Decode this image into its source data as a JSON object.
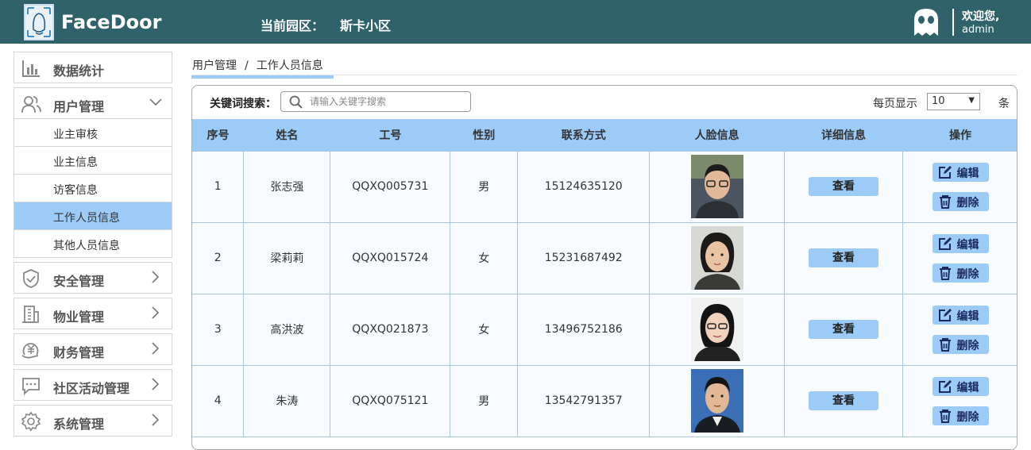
{
  "header": {
    "brand": "FaceDoor",
    "park_label": "当前园区：",
    "park_name": "斯卡小区",
    "welcome": "欢迎您,",
    "username": "admin"
  },
  "sidebar": {
    "items": [
      {
        "label": "数据统计",
        "icon": "bar-chart-icon"
      },
      {
        "label": "用户管理",
        "icon": "users-icon",
        "expanded": true
      },
      {
        "label": "安全管理",
        "icon": "shield-icon"
      },
      {
        "label": "物业管理",
        "icon": "building-icon"
      },
      {
        "label": "财务管理",
        "icon": "money-icon"
      },
      {
        "label": "社区活动管理",
        "icon": "chat-icon"
      },
      {
        "label": "系统管理",
        "icon": "gear-icon"
      }
    ],
    "sub_items": [
      {
        "label": "业主审核"
      },
      {
        "label": "业主信息"
      },
      {
        "label": "访客信息"
      },
      {
        "label": "工作人员信息",
        "active": true
      },
      {
        "label": "其他人员信息"
      }
    ]
  },
  "breadcrumb": {
    "parent": "用户管理",
    "separator": "/",
    "current": "工作人员信息"
  },
  "search": {
    "label": "关键词搜索：",
    "placeholder": "请输入关键字搜索",
    "value": ""
  },
  "pagination": {
    "label": "每页显示",
    "selected": "10",
    "unit": "条"
  },
  "table": {
    "columns": [
      "序号",
      "姓名",
      "工号",
      "性别",
      "联系方式",
      "人脸信息",
      "详细信息",
      "操作"
    ],
    "view_label": "查看",
    "edit_label": "编辑",
    "delete_label": "删除",
    "rows": [
      {
        "no": "1",
        "name": "张志强",
        "id": "QQXQ005731",
        "gender": "男",
        "phone": "15124635120"
      },
      {
        "no": "2",
        "name": "梁莉莉",
        "id": "QQXQ015724",
        "gender": "女",
        "phone": "15231687492"
      },
      {
        "no": "3",
        "name": "高洪波",
        "id": "QQXQ021873",
        "gender": "女",
        "phone": "13496752186"
      },
      {
        "no": "4",
        "name": "朱涛",
        "id": "QQXQ075121",
        "gender": "男",
        "phone": "13542791357"
      }
    ]
  },
  "colors": {
    "header_bg": "#30626b",
    "accent": "#9ccbf8",
    "button_text": "#1c2a63"
  }
}
